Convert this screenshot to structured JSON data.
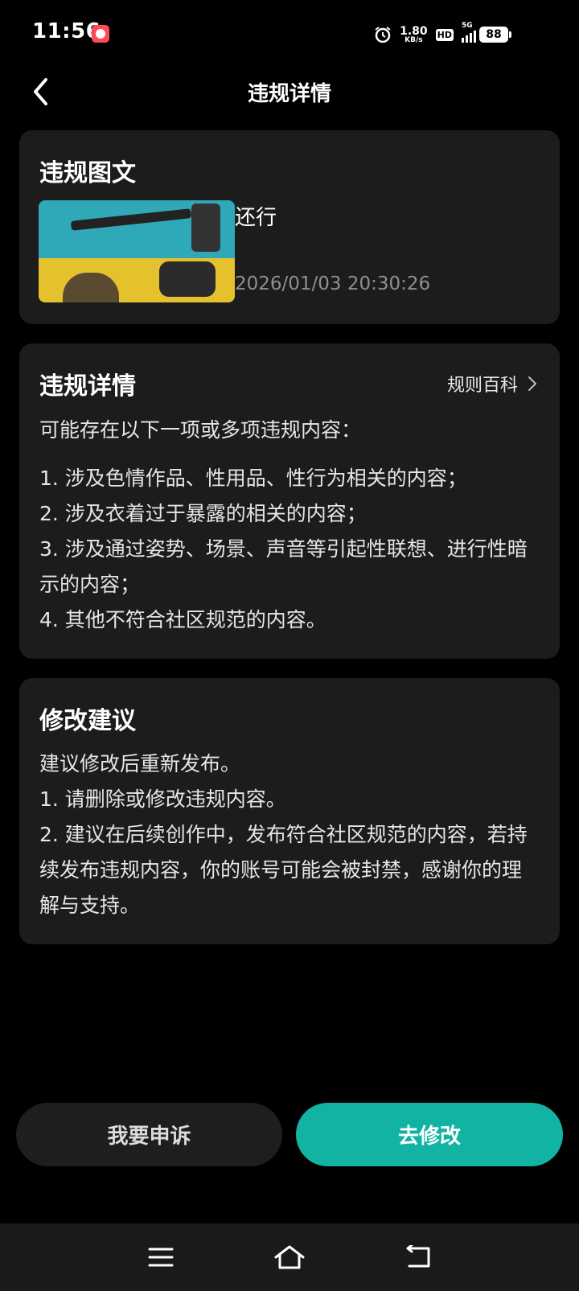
{
  "status_bar": {
    "time": "11:56",
    "net_speed": "1.80",
    "net_speed_unit": "KB/s",
    "hd_label": "HD",
    "network_type": "5G",
    "battery": "88",
    "icons": [
      "app-badge-icon",
      "alarm-icon",
      "signal-icon",
      "wifi-icon",
      "battery-icon"
    ]
  },
  "header": {
    "title": "违规详情",
    "back_icon": "chevron-left-icon"
  },
  "violation_post": {
    "section_title": "违规图文",
    "post_text": "还行",
    "timestamp": "2026/01/03 20:30:26"
  },
  "violation_details": {
    "section_title": "违规详情",
    "link_label": "规则百科",
    "intro": "可能存在以下一项或多项违规内容：",
    "items": [
      "1. 涉及色情作品、性用品、性行为相关的内容；",
      "2. 涉及衣着过于暴露的相关的内容；",
      "3. 涉及通过姿势、场景、声音等引起性联想、进行性暗示的内容；",
      "4. 其他不符合社区规范的内容。"
    ]
  },
  "suggestions": {
    "section_title": "修改建议",
    "lines": [
      "建议修改后重新发布。",
      "1. 请删除或修改违规内容。",
      "2. 建议在后续创作中，发布符合社区规范的内容，若持续发布违规内容，你的账号可能会被封禁，感谢你的理解与支持。"
    ]
  },
  "actions": {
    "appeal_label": "我要申诉",
    "modify_label": "去修改"
  },
  "colors": {
    "background": "#000000",
    "card": "#1c1c1c",
    "accent": "#12b3a3",
    "secondary_text": "#8f8f8f"
  },
  "nav_bar": {
    "icons": [
      "menu-icon",
      "home-icon",
      "back-icon"
    ]
  }
}
